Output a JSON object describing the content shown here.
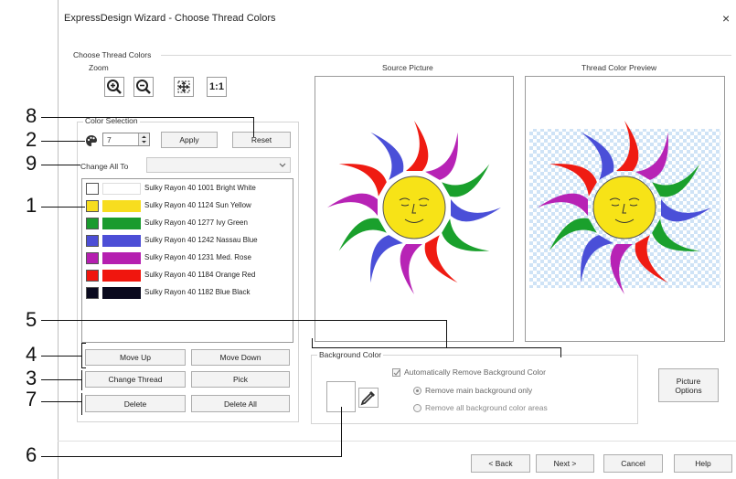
{
  "window": {
    "title": "ExpressDesign Wizard - Choose Thread Colors",
    "close_glyph": "×"
  },
  "section": {
    "choose_thread_colors": "Choose Thread Colors",
    "zoom": "Zoom"
  },
  "zoom_buttons": [
    {
      "name": "zoom-in-icon"
    },
    {
      "name": "zoom-out-icon"
    },
    {
      "name": "zoom-fit-icon"
    },
    {
      "name": "zoom-actual-icon",
      "label": "1:1"
    }
  ],
  "color_selection": {
    "title": "Color Selection",
    "count_value": "7",
    "apply": "Apply",
    "reset": "Reset",
    "change_all_to": "Change All To",
    "threads": [
      {
        "label": "Sulky Rayon 40 1001 Bright White",
        "color": "#ffffff"
      },
      {
        "label": "Sulky Rayon 40 1124 Sun Yellow",
        "color": "#f7dd1f"
      },
      {
        "label": "Sulky Rayon 40 1277 Ivy Green",
        "color": "#1a9b2e"
      },
      {
        "label": "Sulky Rayon 40 1242 Nassau Blue",
        "color": "#4c4ed6"
      },
      {
        "label": "Sulky Rayon 40 1231 Med. Rose",
        "color": "#b51fb0"
      },
      {
        "label": "Sulky Rayon 40 1184 Orange Red",
        "color": "#f0160e"
      },
      {
        "label": "Sulky Rayon 40 1182 Blue Black",
        "color": "#0a0a1e"
      }
    ],
    "move_up": "Move Up",
    "move_down": "Move Down",
    "change_thread": "Change Thread",
    "pick": "Pick",
    "delete": "Delete",
    "delete_all": "Delete All"
  },
  "source_picture": {
    "title": "Source Picture"
  },
  "thread_preview": {
    "title": "Thread Color Preview"
  },
  "background": {
    "title": "Background Color",
    "auto_remove": "Automatically Remove Background Color",
    "remove_main": "Remove main background only",
    "remove_all": "Remove all background color areas"
  },
  "picture_options": {
    "line1": "Picture",
    "line2": "Options"
  },
  "footer": {
    "back": "< Back",
    "next": "Next >",
    "cancel": "Cancel",
    "help": "Help"
  },
  "callouts": {
    "c1": "1",
    "c2": "2",
    "c3": "3",
    "c4": "4",
    "c5": "5",
    "c6": "6",
    "c7": "7",
    "c8": "8",
    "c9": "9"
  },
  "sun_colors": {
    "yellow": "#f7e317",
    "red": "#ef1b12",
    "green": "#1aa02c",
    "blue": "#4a4fd8",
    "magenta": "#b723b5",
    "face": "#f7e317"
  }
}
